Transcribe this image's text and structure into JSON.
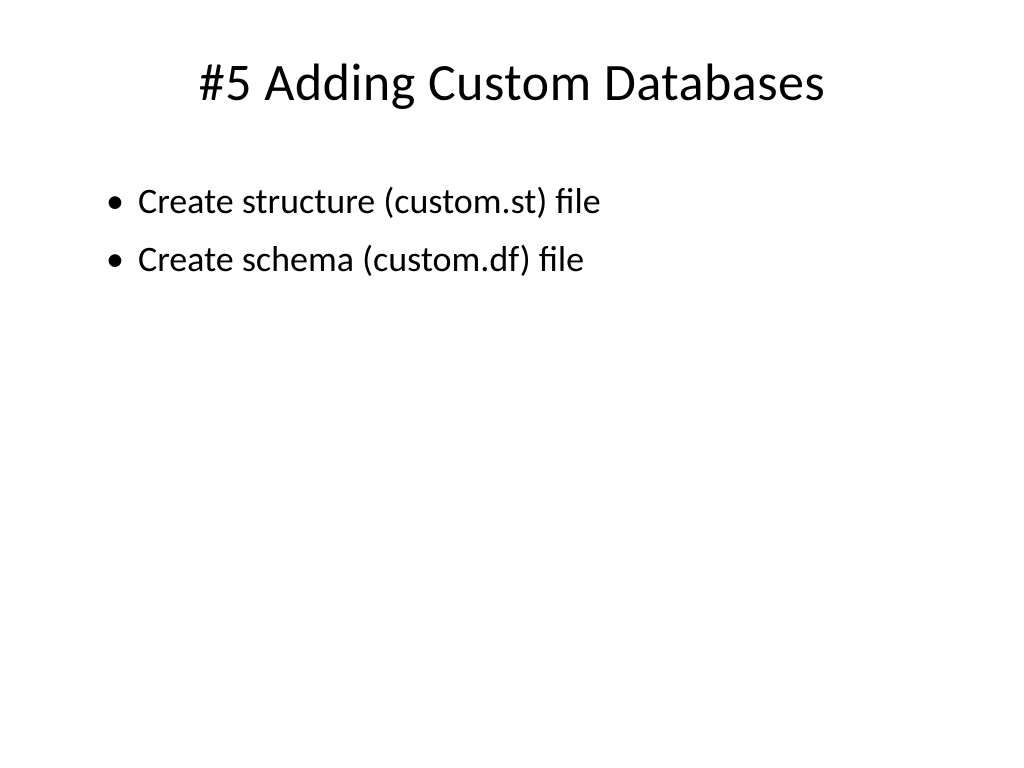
{
  "slide": {
    "title": "#5 Adding Custom Databases",
    "bullets": [
      "Create structure (custom.st) file",
      "Create schema (custom.df) file"
    ]
  }
}
